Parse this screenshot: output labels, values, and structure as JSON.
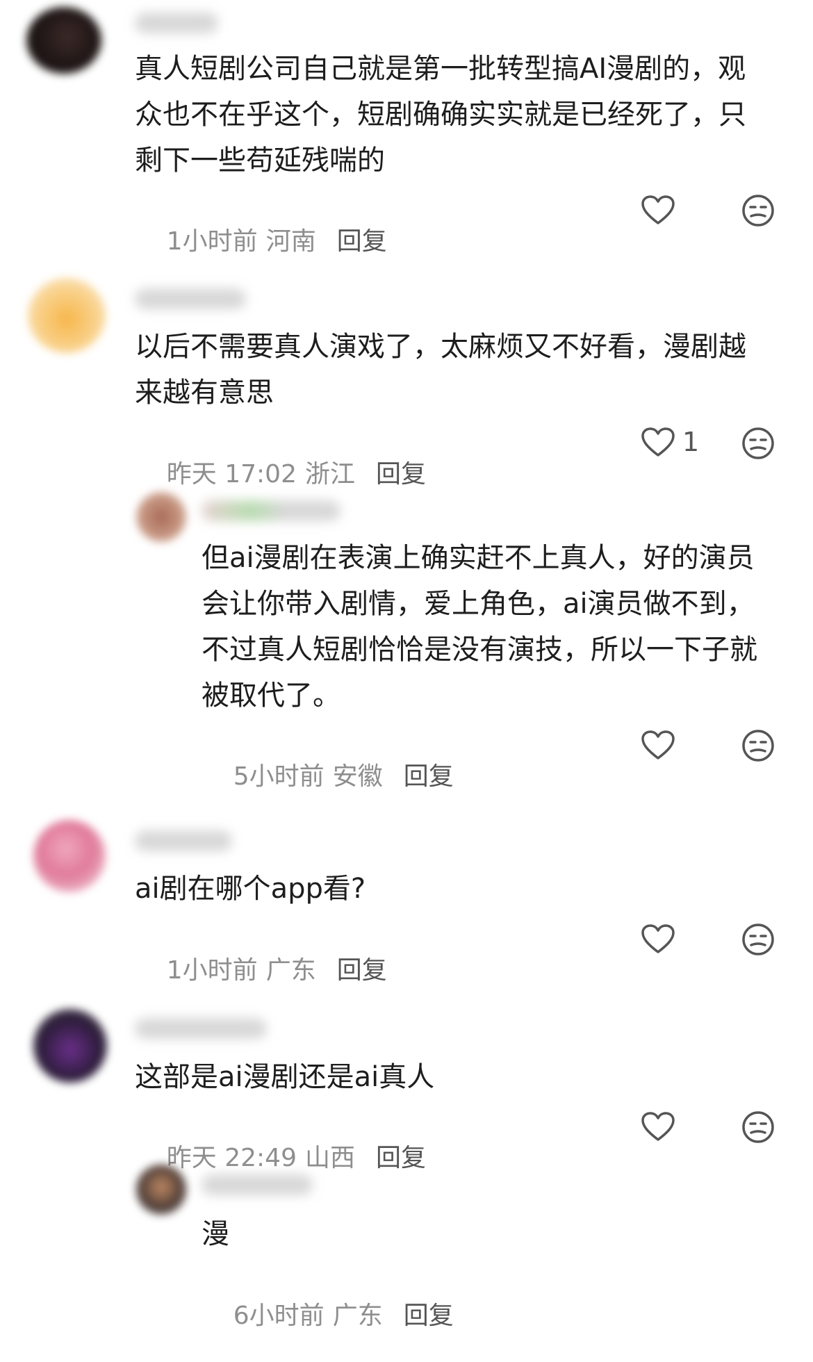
{
  "comments": [
    {
      "text_lines": [
        "真人短剧公司自己就是第一批转型搞AI漫剧的，观",
        "众也不在乎这个，短剧确确实实就是已经死了，只",
        "剩下一些苟延残喘的"
      ],
      "time": "1小时前",
      "location": "河南",
      "reply_label": "回复",
      "like_count": ""
    },
    {
      "text_lines": [
        "以后不需要真人演戏了，太麻烦又不好看，漫剧越",
        "来越有意思"
      ],
      "time": "昨天 17:02",
      "location": "浙江",
      "reply_label": "回复",
      "like_count": "1"
    },
    {
      "text_lines": [
        "但ai漫剧在表演上确实赶不上真人，好的演员",
        "会让你带入剧情，爱上角色，ai演员做不到，",
        "不过真人短剧恰恰是没有演技，所以一下子就",
        "被取代了。"
      ],
      "time": "5小时前",
      "location": "安徽",
      "reply_label": "回复",
      "like_count": ""
    },
    {
      "text_lines": [
        "ai剧在哪个app看?"
      ],
      "time": "1小时前",
      "location": "广东",
      "reply_label": "回复",
      "like_count": ""
    },
    {
      "text_lines": [
        "这部是ai漫剧还是ai真人"
      ],
      "time": "昨天 22:49",
      "location": "山西",
      "reply_label": "回复",
      "like_count": ""
    },
    {
      "text_lines": [
        "漫"
      ],
      "time": "6小时前",
      "location": "广东",
      "reply_label": "回复",
      "like_count": ""
    }
  ],
  "icons": {
    "like": "heart-outline-icon",
    "dislike": "neutral-face-icon"
  },
  "colors": {
    "text": "#1d1d1d",
    "meta": "#8e8e8e",
    "reply": "#555555",
    "icon": "#555555"
  }
}
